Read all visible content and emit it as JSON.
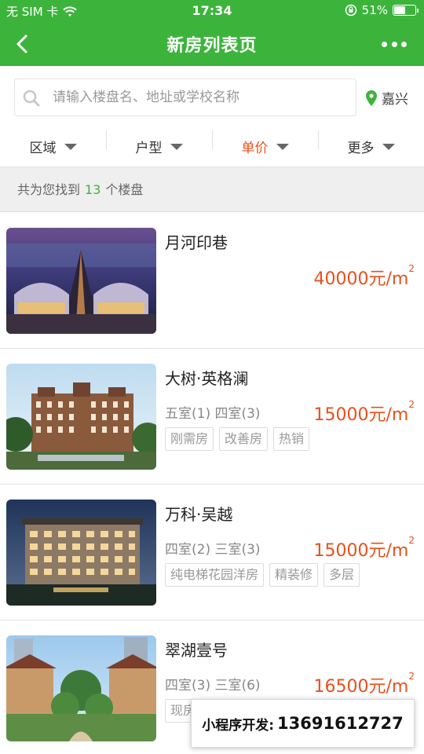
{
  "status_bar": {
    "carrier": "无 SIM 卡",
    "time": "17:34",
    "battery": "51%"
  },
  "nav": {
    "title": "新房列表页"
  },
  "search": {
    "placeholder": "请输入楼盘名、地址或学校名称",
    "value": "",
    "city": "嘉兴"
  },
  "filters": [
    {
      "label": "区域",
      "active": false
    },
    {
      "label": "户型",
      "active": false
    },
    {
      "label": "单价",
      "active": true
    },
    {
      "label": "更多",
      "active": false
    }
  ],
  "count": {
    "prefix": "共为您找到",
    "number": "13",
    "suffix": "个楼盘"
  },
  "listings": [
    {
      "name": "月河印巷",
      "rooms": "",
      "price": "40000元/m",
      "unit_sup": "2",
      "tags": []
    },
    {
      "name": "大树·英格澜",
      "rooms": "五室(1) 四室(3)",
      "price": "15000元/m",
      "unit_sup": "2",
      "tags": [
        "刚需房",
        "改善房",
        "热销"
      ]
    },
    {
      "name": "万科·吴越",
      "rooms": "四室(2) 三室(3)",
      "price": "15000元/m",
      "unit_sup": "2",
      "tags": [
        "纯电梯花园洋房",
        "精装修",
        "多层"
      ]
    },
    {
      "name": "翠湖壹号",
      "rooms": "四室(3) 三室(6)",
      "price": "16500元/m",
      "unit_sup": "2",
      "tags": [
        "现房"
      ]
    }
  ],
  "promo": {
    "label": "小程序开发:",
    "phone": "13691612727"
  },
  "colors": {
    "brand_green": "#3cb43c",
    "price_orange": "#e8501c"
  }
}
